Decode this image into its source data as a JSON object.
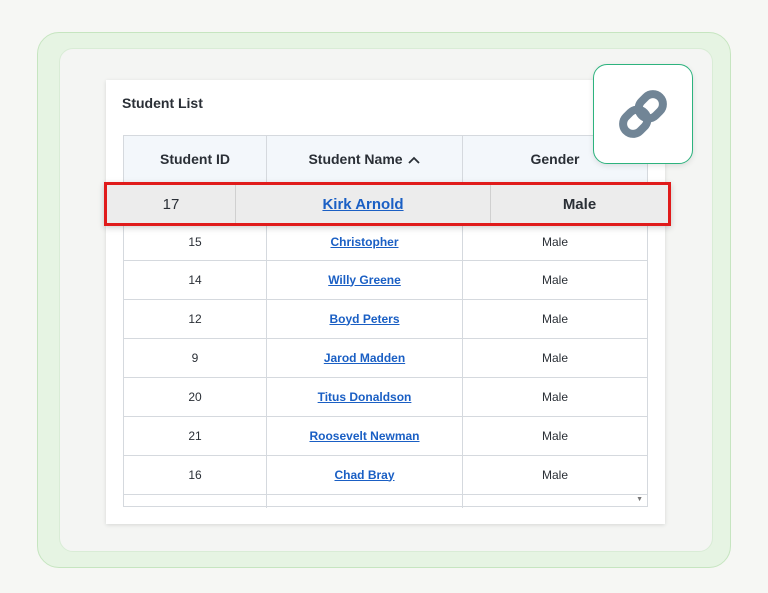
{
  "card": {
    "title": "Student List"
  },
  "table": {
    "columns": [
      "Student ID",
      "Student Name",
      "Gender"
    ],
    "sorted_column": "Student Name",
    "sort_direction": "ascending",
    "selected_row": {
      "id": "17",
      "name": "Kirk Arnold",
      "gender": "Male"
    },
    "rows": [
      {
        "id": "15",
        "name": "Christopher",
        "gender": "Male"
      },
      {
        "id": "14",
        "name": "Willy Greene",
        "gender": "Male"
      },
      {
        "id": "12",
        "name": "Boyd Peters",
        "gender": "Male"
      },
      {
        "id": "9",
        "name": "Jarod Madden",
        "gender": "Male"
      },
      {
        "id": "20",
        "name": "Titus Donaldson",
        "gender": "Male"
      },
      {
        "id": "21",
        "name": "Roosevelt Newman",
        "gender": "Male"
      },
      {
        "id": "16",
        "name": "Chad Bray",
        "gender": "Male"
      }
    ]
  },
  "icons": {
    "sort": "chevron-up-icon",
    "badge": "link-icon",
    "scroll": "scroll-down-icon"
  },
  "colors": {
    "highlight_border": "#e01b1b",
    "link": "#1a5fc4",
    "badge_border": "#2db37e",
    "link_icon": "#718596"
  }
}
